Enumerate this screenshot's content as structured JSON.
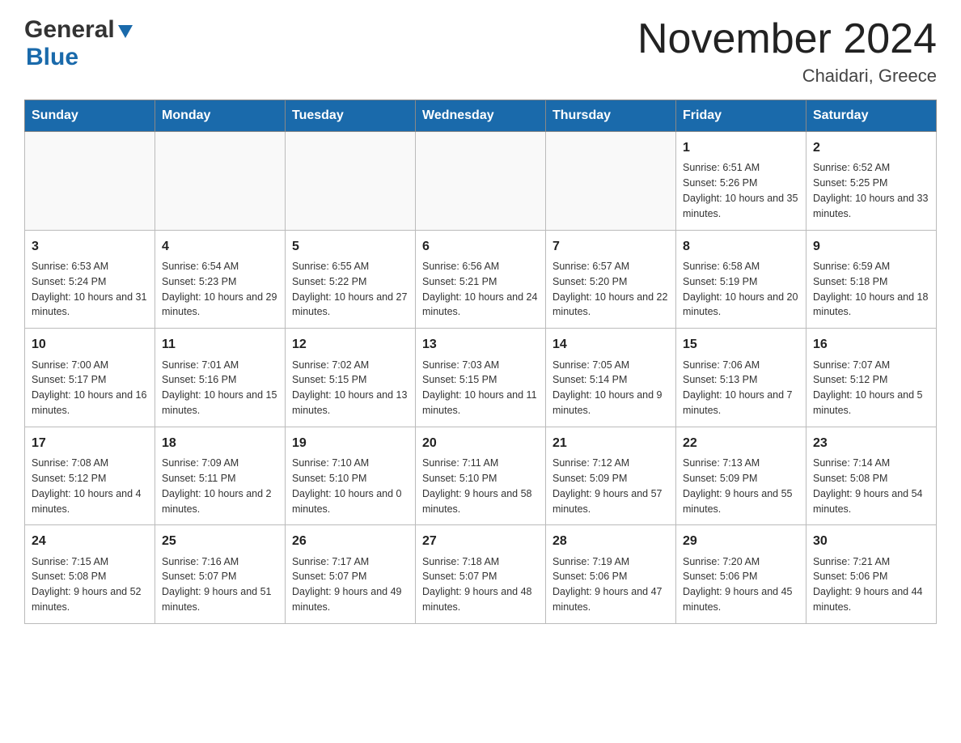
{
  "header": {
    "logo_general": "General",
    "logo_blue": "Blue",
    "month_title": "November 2024",
    "location": "Chaidari, Greece"
  },
  "weekdays": [
    "Sunday",
    "Monday",
    "Tuesday",
    "Wednesday",
    "Thursday",
    "Friday",
    "Saturday"
  ],
  "weeks": [
    [
      {
        "day": "",
        "info": ""
      },
      {
        "day": "",
        "info": ""
      },
      {
        "day": "",
        "info": ""
      },
      {
        "day": "",
        "info": ""
      },
      {
        "day": "",
        "info": ""
      },
      {
        "day": "1",
        "info": "Sunrise: 6:51 AM\nSunset: 5:26 PM\nDaylight: 10 hours and 35 minutes."
      },
      {
        "day": "2",
        "info": "Sunrise: 6:52 AM\nSunset: 5:25 PM\nDaylight: 10 hours and 33 minutes."
      }
    ],
    [
      {
        "day": "3",
        "info": "Sunrise: 6:53 AM\nSunset: 5:24 PM\nDaylight: 10 hours and 31 minutes."
      },
      {
        "day": "4",
        "info": "Sunrise: 6:54 AM\nSunset: 5:23 PM\nDaylight: 10 hours and 29 minutes."
      },
      {
        "day": "5",
        "info": "Sunrise: 6:55 AM\nSunset: 5:22 PM\nDaylight: 10 hours and 27 minutes."
      },
      {
        "day": "6",
        "info": "Sunrise: 6:56 AM\nSunset: 5:21 PM\nDaylight: 10 hours and 24 minutes."
      },
      {
        "day": "7",
        "info": "Sunrise: 6:57 AM\nSunset: 5:20 PM\nDaylight: 10 hours and 22 minutes."
      },
      {
        "day": "8",
        "info": "Sunrise: 6:58 AM\nSunset: 5:19 PM\nDaylight: 10 hours and 20 minutes."
      },
      {
        "day": "9",
        "info": "Sunrise: 6:59 AM\nSunset: 5:18 PM\nDaylight: 10 hours and 18 minutes."
      }
    ],
    [
      {
        "day": "10",
        "info": "Sunrise: 7:00 AM\nSunset: 5:17 PM\nDaylight: 10 hours and 16 minutes."
      },
      {
        "day": "11",
        "info": "Sunrise: 7:01 AM\nSunset: 5:16 PM\nDaylight: 10 hours and 15 minutes."
      },
      {
        "day": "12",
        "info": "Sunrise: 7:02 AM\nSunset: 5:15 PM\nDaylight: 10 hours and 13 minutes."
      },
      {
        "day": "13",
        "info": "Sunrise: 7:03 AM\nSunset: 5:15 PM\nDaylight: 10 hours and 11 minutes."
      },
      {
        "day": "14",
        "info": "Sunrise: 7:05 AM\nSunset: 5:14 PM\nDaylight: 10 hours and 9 minutes."
      },
      {
        "day": "15",
        "info": "Sunrise: 7:06 AM\nSunset: 5:13 PM\nDaylight: 10 hours and 7 minutes."
      },
      {
        "day": "16",
        "info": "Sunrise: 7:07 AM\nSunset: 5:12 PM\nDaylight: 10 hours and 5 minutes."
      }
    ],
    [
      {
        "day": "17",
        "info": "Sunrise: 7:08 AM\nSunset: 5:12 PM\nDaylight: 10 hours and 4 minutes."
      },
      {
        "day": "18",
        "info": "Sunrise: 7:09 AM\nSunset: 5:11 PM\nDaylight: 10 hours and 2 minutes."
      },
      {
        "day": "19",
        "info": "Sunrise: 7:10 AM\nSunset: 5:10 PM\nDaylight: 10 hours and 0 minutes."
      },
      {
        "day": "20",
        "info": "Sunrise: 7:11 AM\nSunset: 5:10 PM\nDaylight: 9 hours and 58 minutes."
      },
      {
        "day": "21",
        "info": "Sunrise: 7:12 AM\nSunset: 5:09 PM\nDaylight: 9 hours and 57 minutes."
      },
      {
        "day": "22",
        "info": "Sunrise: 7:13 AM\nSunset: 5:09 PM\nDaylight: 9 hours and 55 minutes."
      },
      {
        "day": "23",
        "info": "Sunrise: 7:14 AM\nSunset: 5:08 PM\nDaylight: 9 hours and 54 minutes."
      }
    ],
    [
      {
        "day": "24",
        "info": "Sunrise: 7:15 AM\nSunset: 5:08 PM\nDaylight: 9 hours and 52 minutes."
      },
      {
        "day": "25",
        "info": "Sunrise: 7:16 AM\nSunset: 5:07 PM\nDaylight: 9 hours and 51 minutes."
      },
      {
        "day": "26",
        "info": "Sunrise: 7:17 AM\nSunset: 5:07 PM\nDaylight: 9 hours and 49 minutes."
      },
      {
        "day": "27",
        "info": "Sunrise: 7:18 AM\nSunset: 5:07 PM\nDaylight: 9 hours and 48 minutes."
      },
      {
        "day": "28",
        "info": "Sunrise: 7:19 AM\nSunset: 5:06 PM\nDaylight: 9 hours and 47 minutes."
      },
      {
        "day": "29",
        "info": "Sunrise: 7:20 AM\nSunset: 5:06 PM\nDaylight: 9 hours and 45 minutes."
      },
      {
        "day": "30",
        "info": "Sunrise: 7:21 AM\nSunset: 5:06 PM\nDaylight: 9 hours and 44 minutes."
      }
    ]
  ]
}
